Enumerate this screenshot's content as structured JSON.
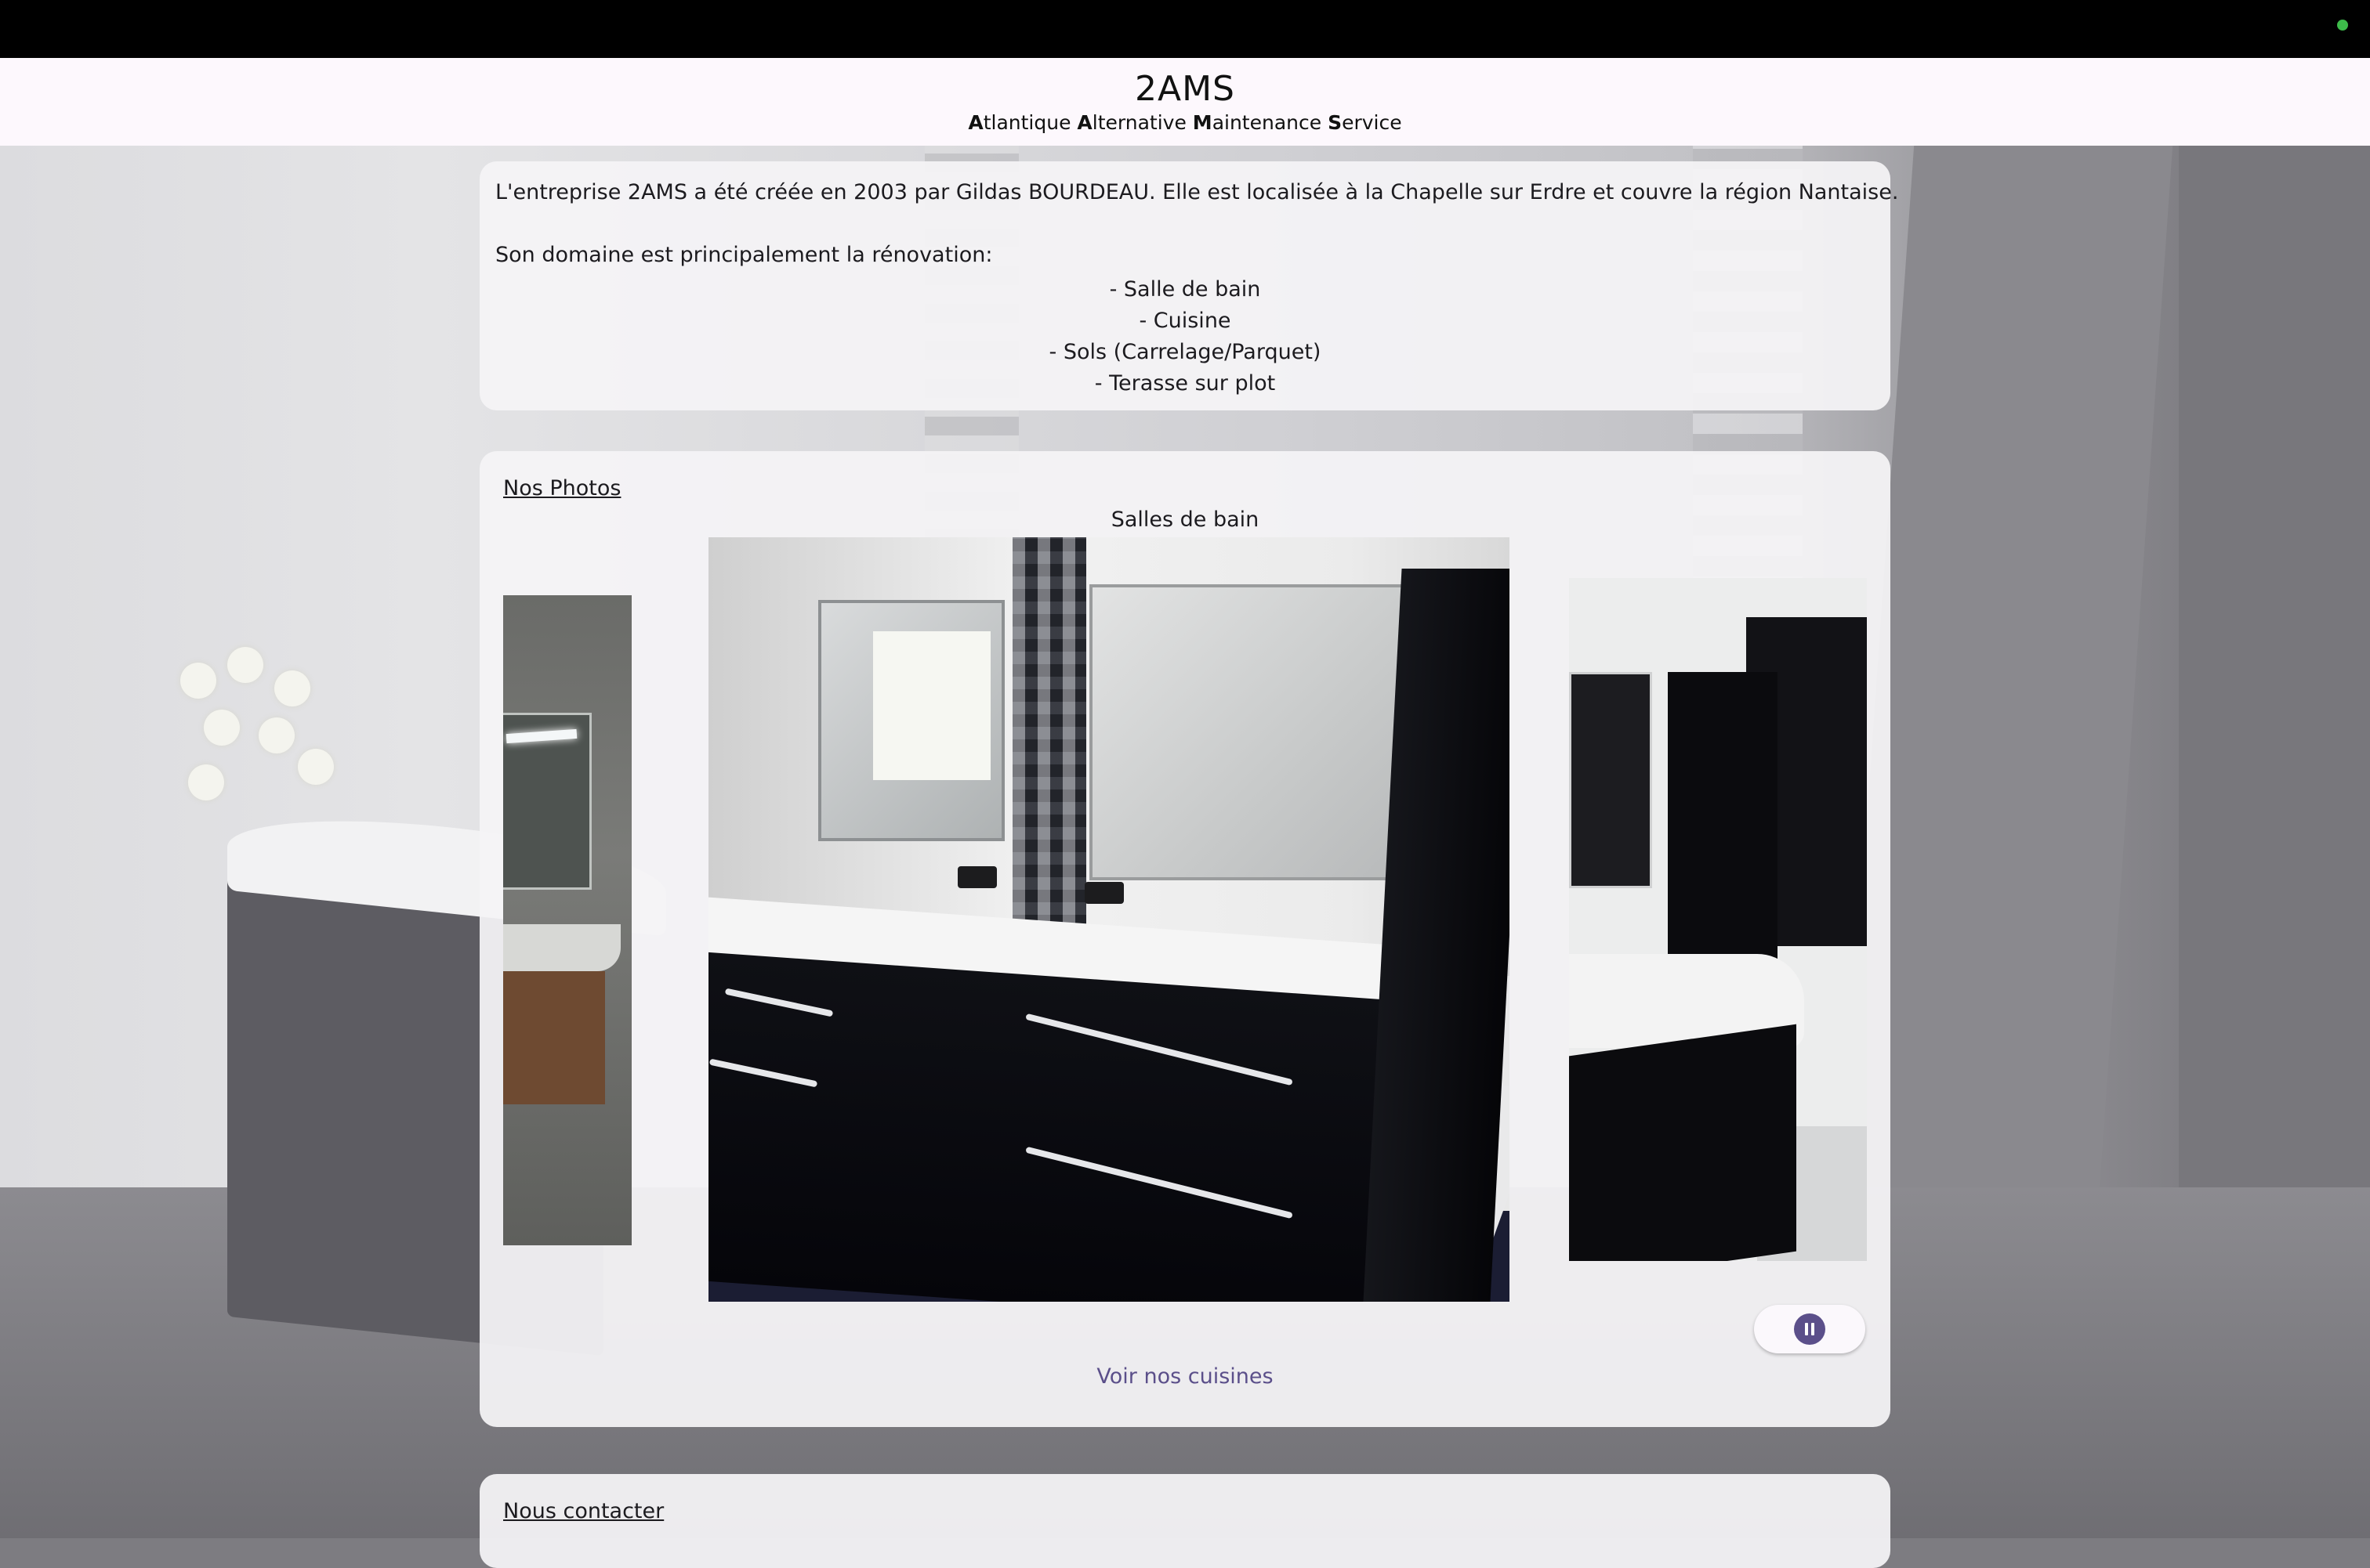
{
  "header": {
    "title": "2AMS",
    "subtitle_parts": [
      {
        "bold": "A",
        "rest": "tlantique "
      },
      {
        "bold": "A",
        "rest": "lternative "
      },
      {
        "bold": "M",
        "rest": "aintenance "
      },
      {
        "bold": "S",
        "rest": "ervice"
      }
    ]
  },
  "intro": {
    "paragraph1": "L'entreprise 2AMS a été créée en 2003 par Gildas BOURDEAU. Elle est localisée à la Chapelle sur Erdre et couvre la région Nantaise.",
    "paragraph2": "Son domaine est principalement la rénovation:",
    "domains": [
      "- Salle de bain",
      "- Cuisine",
      "- Sols (Carrelage/Parquet)",
      "- Terasse sur plot"
    ]
  },
  "photos": {
    "heading": "Nos Photos",
    "carousel_caption": "Salles de bain",
    "pause_icon": "pause-icon",
    "next_link": "Voir nos cuisines"
  },
  "contact": {
    "heading": "Nous contacter"
  },
  "colors": {
    "accent": "#5b4f8a",
    "header_bg": "#fdf8fd",
    "status_dot": "#3dbb4a"
  }
}
